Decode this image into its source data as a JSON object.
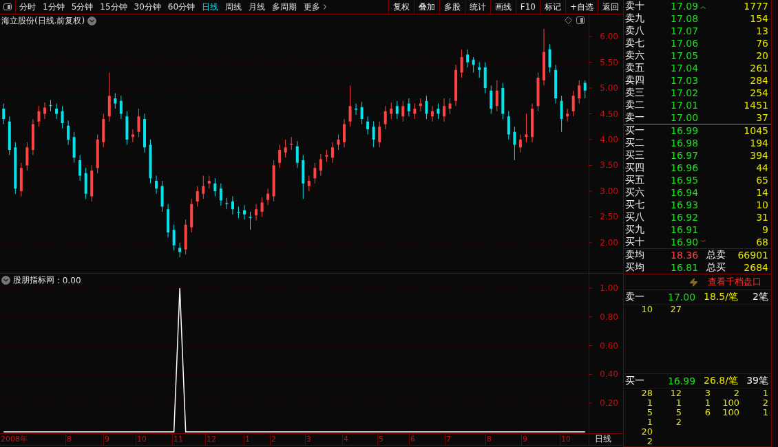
{
  "toolbar": {
    "periods": [
      {
        "label": "分时",
        "selected": false
      },
      {
        "label": "1分钟",
        "selected": false
      },
      {
        "label": "5分钟",
        "selected": false
      },
      {
        "label": "15分钟",
        "selected": false
      },
      {
        "label": "30分钟",
        "selected": false
      },
      {
        "label": "60分钟",
        "selected": false
      },
      {
        "label": "日线",
        "selected": true
      },
      {
        "label": "周线",
        "selected": false
      },
      {
        "label": "月线",
        "selected": false
      },
      {
        "label": "多周期",
        "selected": false
      },
      {
        "label": "更多",
        "selected": false
      }
    ],
    "actions": [
      "复权",
      "叠加",
      "多股",
      "统计",
      "画线",
      "F10",
      "标记",
      "+自选",
      "返回"
    ]
  },
  "price_chart": {
    "title": "海立股份(日线.前复权)",
    "chart_data": {
      "type": "candlestick",
      "grid": true,
      "ylim": [
        1.413,
        6.427
      ],
      "yticks": [
        {
          "value": 6,
          "label": "6.00"
        },
        {
          "value": 5.5,
          "label": "5.50"
        },
        {
          "value": 5,
          "label": "5.00"
        },
        {
          "value": 4.5,
          "label": "4.50"
        },
        {
          "value": 4,
          "label": "4.00"
        },
        {
          "value": 3.5,
          "label": "3.50"
        },
        {
          "value": 3,
          "label": "3.00"
        },
        {
          "value": 2.5,
          "label": "2.50"
        },
        {
          "value": 2,
          "label": "2.00"
        }
      ],
      "categories": [
        null,
        null,
        null,
        null,
        null,
        null,
        null,
        null,
        null,
        null,
        null,
        null,
        null,
        null,
        null,
        null,
        null,
        null,
        null,
        null,
        null,
        null,
        null,
        null,
        null,
        null,
        null,
        null,
        null,
        null,
        null,
        null,
        null,
        null,
        null,
        null,
        null,
        null,
        null,
        null,
        null,
        null,
        null,
        null,
        null,
        null,
        null,
        null,
        null,
        null,
        null,
        null,
        null,
        null,
        null,
        null,
        null,
        null,
        null,
        null,
        null,
        null,
        null,
        null,
        null,
        null,
        null,
        null,
        null,
        null,
        null,
        null,
        null,
        null,
        null,
        null,
        null,
        null,
        null,
        null,
        null,
        null,
        null,
        null,
        null,
        null,
        null,
        null,
        null,
        null,
        null,
        null,
        null,
        null,
        null,
        null,
        null,
        null,
        null,
        null
      ],
      "ohlc": [
        [
          4.6,
          4.7,
          4.3,
          4.4
        ],
        [
          4.35,
          4.45,
          3.7,
          3.8
        ],
        [
          3.85,
          3.95,
          2.95,
          3.05
        ],
        [
          3.0,
          3.55,
          2.9,
          3.45
        ],
        [
          3.5,
          3.95,
          3.4,
          3.85
        ],
        [
          3.8,
          4.4,
          3.7,
          4.3
        ],
        [
          4.35,
          4.65,
          4.25,
          4.55
        ],
        [
          4.5,
          4.72,
          4.4,
          4.62
        ],
        [
          4.67,
          4.77,
          4.55,
          4.65
        ],
        [
          4.6,
          4.7,
          4.4,
          4.5
        ],
        [
          4.55,
          4.65,
          4.22,
          4.32
        ],
        [
          4.27,
          4.37,
          3.9,
          4.0
        ],
        [
          4.05,
          4.15,
          3.55,
          3.65
        ],
        [
          3.6,
          3.7,
          3.2,
          3.3
        ],
        [
          3.35,
          3.45,
          2.85,
          2.95
        ],
        [
          2.9,
          3.5,
          2.8,
          3.4
        ],
        [
          3.45,
          4.1,
          3.35,
          4.0
        ],
        [
          3.95,
          4.5,
          3.85,
          4.4
        ],
        [
          4.45,
          5.3,
          4.35,
          4.85
        ],
        [
          4.8,
          4.9,
          4.6,
          4.7
        ],
        [
          4.75,
          4.85,
          4.4,
          4.5
        ],
        [
          4.45,
          4.55,
          3.9,
          4.0
        ],
        [
          4.05,
          4.2,
          3.95,
          4.1
        ],
        [
          4.15,
          4.6,
          4.05,
          4.45
        ],
        [
          4.4,
          4.5,
          3.75,
          3.85
        ],
        [
          3.9,
          4.0,
          3.15,
          3.25
        ],
        [
          3.2,
          3.3,
          2.95,
          3.05
        ],
        [
          3.1,
          3.2,
          2.6,
          2.7
        ],
        [
          2.65,
          2.75,
          2.1,
          2.2
        ],
        [
          2.25,
          2.35,
          1.85,
          1.95
        ],
        [
          1.9,
          2.0,
          1.72,
          1.82
        ],
        [
          1.87,
          2.45,
          1.77,
          2.35
        ],
        [
          2.3,
          2.85,
          2.2,
          2.75
        ],
        [
          2.8,
          3.1,
          2.7,
          3.0
        ],
        [
          2.95,
          3.3,
          2.85,
          3.1
        ],
        [
          3.15,
          3.3,
          3.05,
          3.2
        ],
        [
          3.15,
          3.25,
          2.9,
          3.0
        ],
        [
          3.05,
          3.15,
          2.72,
          2.82
        ],
        [
          2.77,
          2.87,
          2.65,
          2.75
        ],
        [
          2.8,
          2.9,
          2.55,
          2.65
        ],
        [
          2.6,
          2.7,
          2.48,
          2.58
        ],
        [
          2.63,
          2.73,
          2.45,
          2.55
        ],
        [
          2.5,
          2.6,
          2.25,
          2.48
        ],
        [
          2.53,
          2.75,
          2.43,
          2.65
        ],
        [
          2.6,
          2.88,
          2.5,
          2.78
        ],
        [
          2.83,
          3.05,
          2.73,
          2.95
        ],
        [
          2.9,
          3.6,
          2.8,
          3.5
        ],
        [
          3.55,
          3.9,
          3.45,
          3.8
        ],
        [
          3.75,
          4.0,
          3.65,
          3.85
        ],
        [
          3.9,
          4.05,
          3.8,
          3.92
        ],
        [
          3.87,
          3.97,
          3.45,
          3.55
        ],
        [
          3.6,
          3.7,
          2.85,
          3.15
        ],
        [
          3.1,
          3.3,
          3.0,
          3.2
        ],
        [
          3.25,
          3.55,
          3.15,
          3.45
        ],
        [
          3.4,
          3.72,
          3.3,
          3.62
        ],
        [
          3.67,
          3.8,
          3.57,
          3.7
        ],
        [
          3.65,
          3.95,
          3.55,
          3.85
        ],
        [
          3.9,
          4.1,
          3.8,
          4.0
        ],
        [
          3.95,
          4.4,
          3.85,
          4.3
        ],
        [
          4.35,
          5.05,
          4.25,
          4.65
        ],
        [
          4.6,
          4.7,
          4.48,
          4.58
        ],
        [
          4.63,
          4.73,
          4.3,
          4.4
        ],
        [
          4.35,
          4.45,
          4.1,
          4.2
        ],
        [
          4.25,
          4.35,
          3.85,
          4.0
        ],
        [
          3.95,
          4.35,
          3.85,
          4.25
        ],
        [
          4.3,
          4.65,
          4.2,
          4.55
        ],
        [
          4.5,
          4.72,
          4.4,
          4.6
        ],
        [
          4.65,
          4.75,
          4.4,
          4.5
        ],
        [
          4.45,
          4.75,
          4.35,
          4.65
        ],
        [
          4.7,
          4.8,
          4.45,
          4.55
        ],
        [
          4.5,
          4.7,
          4.4,
          4.6
        ],
        [
          4.65,
          4.8,
          4.55,
          4.7
        ],
        [
          4.75,
          4.85,
          4.4,
          4.5
        ],
        [
          4.45,
          4.65,
          4.35,
          4.55
        ],
        [
          4.6,
          4.7,
          4.4,
          4.5
        ],
        [
          4.45,
          4.8,
          4.35,
          4.65
        ],
        [
          4.6,
          4.8,
          4.5,
          4.7
        ],
        [
          4.75,
          5.45,
          4.65,
          5.35
        ],
        [
          5.3,
          5.75,
          5.2,
          5.6
        ],
        [
          5.65,
          5.75,
          5.4,
          5.5
        ],
        [
          5.55,
          5.6,
          5.3,
          5.45
        ],
        [
          5.4,
          5.5,
          5.2,
          5.35
        ],
        [
          5.4,
          5.5,
          4.9,
          5.0
        ],
        [
          4.95,
          5.05,
          4.5,
          4.6
        ],
        [
          4.65,
          5.15,
          4.55,
          4.95
        ],
        [
          5.0,
          5.1,
          4.4,
          4.5
        ],
        [
          4.45,
          4.55,
          4.0,
          4.1
        ],
        [
          4.15,
          4.25,
          3.6,
          3.9
        ],
        [
          3.85,
          4.1,
          3.75,
          4.0
        ],
        [
          4.05,
          4.5,
          3.95,
          4.1
        ],
        [
          4.05,
          4.7,
          3.95,
          4.6
        ],
        [
          4.65,
          5.3,
          4.55,
          5.2
        ],
        [
          5.15,
          6.15,
          5.05,
          5.7
        ],
        [
          5.75,
          5.85,
          5.3,
          5.4
        ],
        [
          5.35,
          5.45,
          4.7,
          4.8
        ],
        [
          4.75,
          4.85,
          4.15,
          4.4
        ],
        [
          4.45,
          4.6,
          4.35,
          4.5
        ],
        [
          4.55,
          4.95,
          4.45,
          4.85
        ],
        [
          4.8,
          5.15,
          4.7,
          5.05
        ],
        [
          5.1,
          5.15,
          4.8,
          4.95
        ]
      ]
    }
  },
  "indicator": {
    "reading": ": 0.00",
    "chart_data": {
      "type": "line",
      "grid": true,
      "ylim": [
        0,
        1.1
      ],
      "yticks": [
        {
          "value": 1,
          "label": "1.00"
        },
        {
          "value": 0.8,
          "label": "0.80"
        },
        {
          "value": 0.6,
          "label": "0.60"
        },
        {
          "value": 0.4,
          "label": "0.40"
        },
        {
          "value": 0.2,
          "label": "0.20"
        }
      ],
      "categories": [
        null,
        null,
        null,
        null,
        null,
        null,
        null,
        null,
        null,
        null,
        null,
        null,
        null,
        null,
        null,
        null,
        null,
        null,
        null,
        null,
        null,
        null,
        null,
        null,
        null,
        null,
        null,
        null,
        null,
        null,
        null,
        null,
        null,
        null,
        null,
        null,
        null,
        null,
        null,
        null,
        null,
        null,
        null,
        null,
        null,
        null,
        null,
        null,
        null,
        null,
        null,
        null,
        null,
        null,
        null,
        null,
        null,
        null,
        null,
        null,
        null,
        null,
        null,
        null,
        null,
        null,
        null,
        null,
        null,
        null,
        null,
        null,
        null,
        null,
        null,
        null,
        null,
        null,
        null,
        null,
        null,
        null,
        null,
        null,
        null,
        null,
        null,
        null,
        null,
        null,
        null,
        null,
        null,
        null,
        null,
        null,
        null,
        null,
        null,
        null
      ],
      "series": [
        {
          "name": "股朋指标网",
          "color": "#ffffff",
          "values": [
            0,
            0,
            0,
            0,
            0,
            0,
            0,
            0,
            0,
            0,
            0,
            0,
            0,
            0,
            0,
            0,
            0,
            0,
            0,
            0,
            0,
            0,
            0,
            0,
            0,
            0,
            0,
            0,
            0,
            0,
            1,
            0,
            0,
            0,
            0,
            0,
            0,
            0,
            0,
            0,
            0,
            0,
            0,
            0,
            0,
            0,
            0,
            0,
            0,
            0,
            0,
            0,
            0,
            0,
            0,
            0,
            0,
            0,
            0,
            0,
            0,
            0,
            0,
            0,
            0,
            0,
            0,
            0,
            0,
            0,
            0,
            0,
            0,
            0,
            0,
            0,
            0,
            0,
            0,
            0,
            0,
            0,
            0,
            0,
            0,
            0,
            0,
            0,
            0,
            0,
            0,
            0,
            0,
            0,
            0,
            0,
            0,
            0,
            0,
            0
          ]
        }
      ]
    }
  },
  "date_axis": {
    "labels": [
      "2008年",
      "8",
      "9",
      "10",
      "11",
      "12",
      "1",
      "2",
      "3",
      "4",
      "5",
      "6",
      "7",
      "8",
      "9",
      "10"
    ],
    "period": "日线"
  },
  "order_book": {
    "asks": [
      {
        "label": "卖十",
        "price": "17.09",
        "volume": "1777",
        "marker": "︽"
      },
      {
        "label": "卖九",
        "price": "17.08",
        "volume": "154"
      },
      {
        "label": "卖八",
        "price": "17.07",
        "volume": "13"
      },
      {
        "label": "卖七",
        "price": "17.06",
        "volume": "76"
      },
      {
        "label": "卖六",
        "price": "17.05",
        "volume": "20"
      },
      {
        "label": "卖五",
        "price": "17.04",
        "volume": "261"
      },
      {
        "label": "卖四",
        "price": "17.03",
        "volume": "284"
      },
      {
        "label": "卖三",
        "price": "17.02",
        "volume": "254"
      },
      {
        "label": "卖二",
        "price": "17.01",
        "volume": "1451"
      },
      {
        "label": "卖一",
        "price": "17.00",
        "volume": "37"
      }
    ],
    "bids": [
      {
        "label": "买一",
        "price": "16.99",
        "volume": "1045"
      },
      {
        "label": "买二",
        "price": "16.98",
        "volume": "194"
      },
      {
        "label": "买三",
        "price": "16.97",
        "volume": "394"
      },
      {
        "label": "买四",
        "price": "16.96",
        "volume": "44"
      },
      {
        "label": "买五",
        "price": "16.95",
        "volume": "65"
      },
      {
        "label": "买六",
        "price": "16.94",
        "volume": "14"
      },
      {
        "label": "买七",
        "price": "16.93",
        "volume": "10"
      },
      {
        "label": "买八",
        "price": "16.92",
        "volume": "31"
      },
      {
        "label": "买九",
        "price": "16.91",
        "volume": "9"
      },
      {
        "label": "买十",
        "price": "16.90",
        "volume": "68",
        "marker": "︾"
      }
    ],
    "summary": [
      {
        "label": "卖均",
        "price": "18.36",
        "color": "#ff4444",
        "total_label": "总卖",
        "total": "66901"
      },
      {
        "label": "买均",
        "price": "16.81",
        "color": "#22dd22",
        "total_label": "总买",
        "total": "2684"
      }
    ],
    "depth_link": "查看千档盘口"
  },
  "queues": [
    {
      "label": "卖一",
      "price": "17.00",
      "average": "18.5/笔",
      "count": "2笔",
      "orders": [
        [
          "10",
          "27"
        ]
      ]
    },
    {
      "label": "买一",
      "price": "16.99",
      "average": "26.8/笔",
      "count": "39笔",
      "orders": [
        [
          "28",
          "12",
          "3",
          "2",
          "1"
        ],
        [
          "1",
          "1",
          "1",
          "100",
          "2"
        ],
        [
          "5",
          "5",
          "6",
          "100",
          "1"
        ],
        [
          "1",
          "2"
        ],
        [
          "20"
        ],
        [
          "2"
        ]
      ]
    }
  ]
}
